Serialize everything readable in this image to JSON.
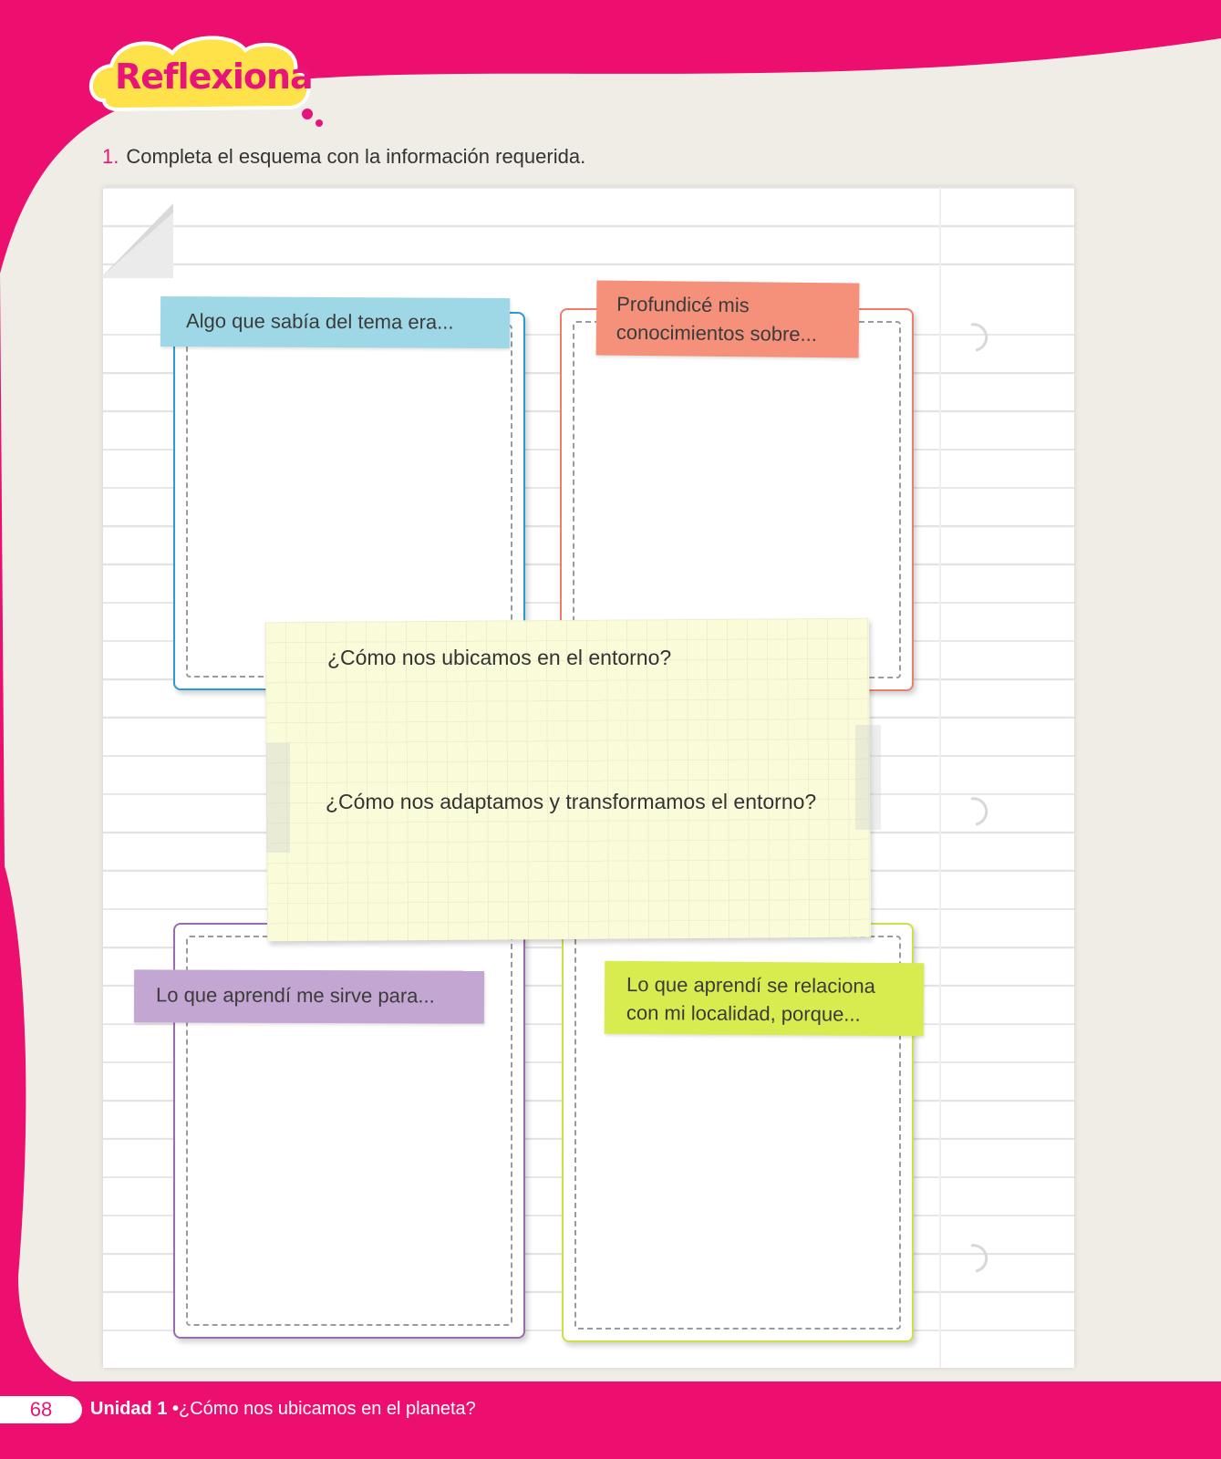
{
  "badge": {
    "label": "Reflexiona"
  },
  "instruction": {
    "number": "1.",
    "text": "Completa el esquema con la información requerida."
  },
  "boxes": [
    {
      "label": "Algo que sabía del tema era...",
      "color": "#2a9bd3",
      "tag_color": "#9ed8e6"
    },
    {
      "label_line1": "Profundicé mis",
      "label_line2": "conocimientos sobre...",
      "color": "#ee7e6b",
      "tag_color": "#f5907a"
    },
    {
      "label": "Lo que aprendí me sirve para...",
      "color": "#9a6bb0",
      "tag_color": "#c4a6d2"
    },
    {
      "label_line1": "Lo que aprendí se relaciona",
      "label_line2": "con mi localidad, porque...",
      "color": "#cfe045",
      "tag_color": "#d9ec4f"
    }
  ],
  "central_note": {
    "question1": "¿Cómo nos ubicamos en el entorno?",
    "question2": "¿Cómo nos adaptamos y transformamos el entorno?"
  },
  "footer": {
    "page_number": "68",
    "unit": "Unidad 1",
    "separator": "•",
    "title": "¿Cómo nos ubicamos en el planeta?"
  }
}
